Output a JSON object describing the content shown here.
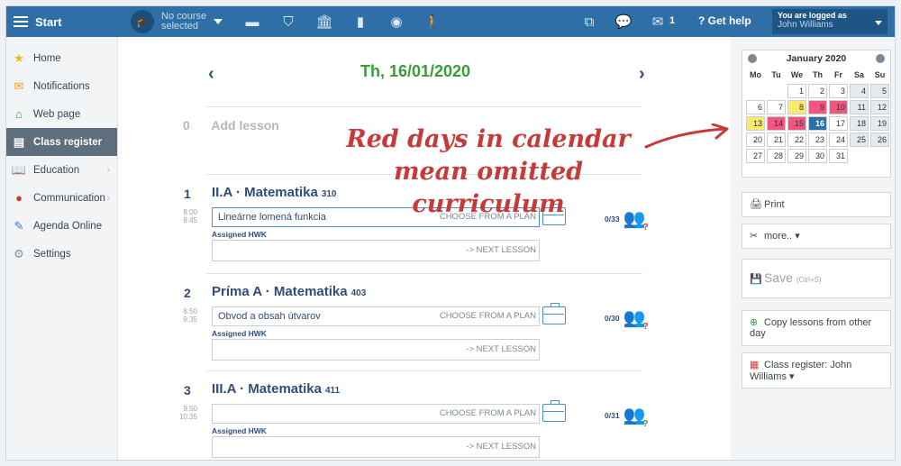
{
  "topbar": {
    "menu_label": "Start",
    "course_line1": "No course",
    "course_line2": "selected",
    "message_count": "1",
    "help_label": "Get help",
    "logged_as": "You are logged as",
    "user_name": "John Williams"
  },
  "sidebar": {
    "items": [
      {
        "label": "Home",
        "icon": "star-icon"
      },
      {
        "label": "Notifications",
        "icon": "envelope-icon"
      },
      {
        "label": "Web page",
        "icon": "house-icon"
      },
      {
        "label": "Class register",
        "icon": "register-icon"
      },
      {
        "label": "Education",
        "icon": "book-icon"
      },
      {
        "label": "Communication",
        "icon": "chat-icon"
      },
      {
        "label": "Agenda Online",
        "icon": "pen-icon"
      },
      {
        "label": "Settings",
        "icon": "gear-icon"
      }
    ]
  },
  "main": {
    "date": "Th, 16/01/2020",
    "add_lesson_num": "0",
    "add_lesson_label": "Add lesson",
    "annotation_line1": "Red days in calendar",
    "annotation_line2": "mean omitted curriculum",
    "plan_label": "CHOOSE FROM A PLAN",
    "hwk_label": "Assigned HWK",
    "next_label": "-> NEXT LESSON",
    "lessons": [
      {
        "num": "1",
        "class": "II.A · Matematika",
        "room": "310",
        "start": "8:00",
        "end": "8:45",
        "topic": "Lineárne lomená funkcia",
        "attendance": "0/33",
        "mark": "?"
      },
      {
        "num": "2",
        "class": "Príma A · Matematika",
        "room": "403",
        "start": "8:50",
        "end": "9:35",
        "topic": "Obvod a obsah útvarov",
        "attendance": "0/30",
        "mark": "?"
      },
      {
        "num": "3",
        "class": "III.A · Matematika",
        "room": "411",
        "start": "9:50",
        "end": "10:35",
        "topic": "",
        "attendance": "0/31",
        "mark": "?"
      }
    ]
  },
  "calendar": {
    "month": "January 2020",
    "dow": [
      "Mo",
      "Tu",
      "We",
      "Th",
      "Fr",
      "Sa",
      "Su"
    ],
    "red_color": "#f2557f",
    "yellow_color": "#fbe96a",
    "today_color": "#2f6fa7"
  },
  "right": {
    "print_label": "Print",
    "more_label": "more.. ▾",
    "save_label": "Save",
    "save_shortcut": "(Ctrl+S)",
    "copy_label": "Copy lessons from other day",
    "register_label": "Class register: John Williams ▾"
  }
}
